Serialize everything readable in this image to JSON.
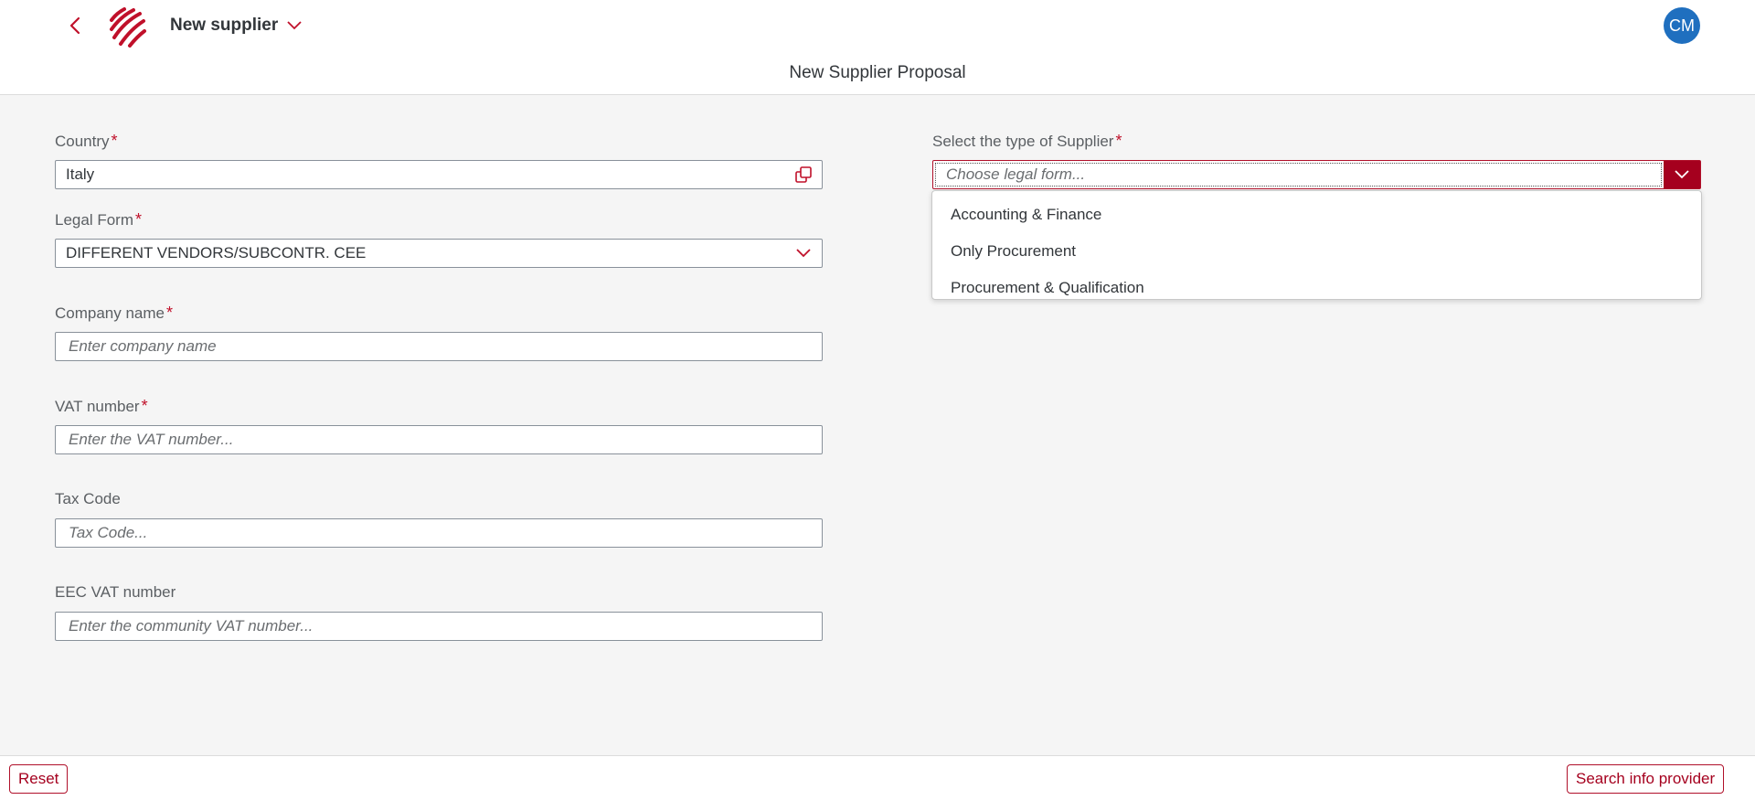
{
  "shell": {
    "app_title": "New supplier",
    "avatar_initials": "CM",
    "accent_color": "#c0102a",
    "icons": [
      "back-icon",
      "brand-logo",
      "chevron-down-icon"
    ]
  },
  "page": {
    "subtitle": "New Supplier Proposal"
  },
  "form": {
    "required_marker": "*",
    "country": {
      "label": "Country",
      "value": "Italy",
      "icon": "value-help-icon"
    },
    "legal_form": {
      "label": "Legal Form",
      "value": "DIFFERENT VENDORS/SUBCONTR. CEE"
    },
    "company_name": {
      "label": "Company name",
      "placeholder": "Enter company name"
    },
    "vat_number": {
      "label": "VAT number",
      "placeholder": "Enter the VAT number..."
    },
    "tax_code": {
      "label": "Tax Code",
      "placeholder": "Tax Code..."
    },
    "eec_vat": {
      "label": "EEC VAT number",
      "placeholder": "Enter the community VAT number..."
    },
    "supplier_type": {
      "label": "Select the type of Supplier",
      "placeholder": "Choose legal form...",
      "options": [
        "Accounting & Finance",
        "Only Procurement",
        "Procurement & Qualification"
      ]
    }
  },
  "footer": {
    "reset_label": "Reset",
    "search_label": "Search info provider"
  }
}
